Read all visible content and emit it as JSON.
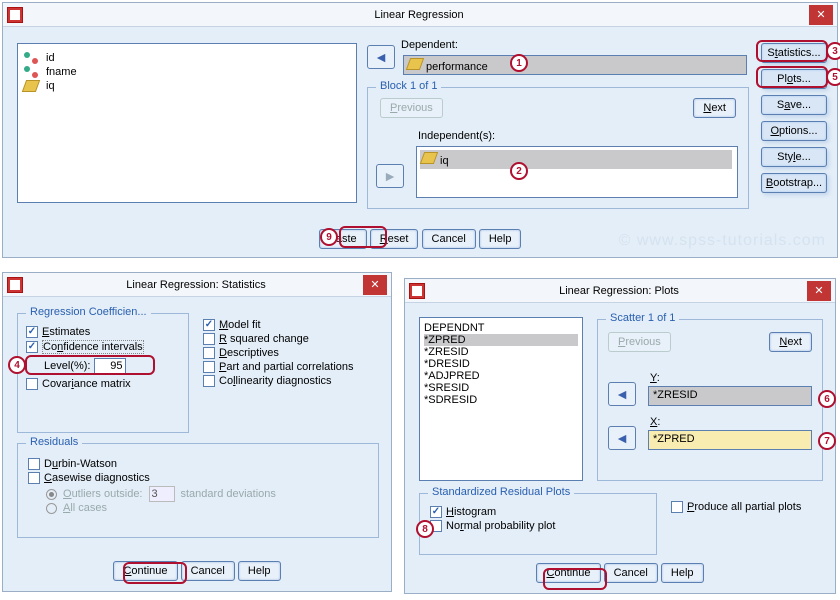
{
  "main": {
    "title": "Linear Regression",
    "vars": [
      {
        "icon": "balls",
        "label": "id"
      },
      {
        "icon": "balls",
        "label": "fname"
      },
      {
        "icon": "ruler",
        "label": "iq"
      }
    ],
    "dependent_label": "Dependent:",
    "dependent_value": "performance",
    "block_label": "Block 1 of 1",
    "previous": "Previous",
    "next": "Next",
    "independent_label": "Independent(s):",
    "independent_value": "iq",
    "buttons": {
      "paste": "Paste",
      "reset": "Reset",
      "cancel": "Cancel",
      "help": "Help"
    },
    "side": {
      "statistics": "Statistics...",
      "plots": "Plots...",
      "save": "Save...",
      "options": "Options...",
      "style": "Style...",
      "bootstrap": "Bootstrap..."
    }
  },
  "stats": {
    "title": "Linear Regression: Statistics",
    "regcoef_label": "Regression Coefficien...",
    "estimates": "Estimates",
    "confint": "Confidence intervals",
    "level_label": "Level(%):",
    "level_value": "95",
    "covmatrix": "Covariance matrix",
    "modelfit": "Model fit",
    "rsq": "R squared change",
    "descriptives": "Descriptives",
    "partcorr": "Part and partial correlations",
    "collin": "Collinearity diagnostics",
    "resid_label": "Residuals",
    "durbin": "Durbin-Watson",
    "casewise": "Casewise diagnostics",
    "outliers": "Outliers outside:",
    "outliers_value": "3",
    "stddev": "standard deviations",
    "allcases": "All cases",
    "continue": "Continue",
    "cancel": "Cancel",
    "help": "Help"
  },
  "plots": {
    "title": "Linear Regression: Plots",
    "list": [
      "DEPENDNT",
      "*ZPRED",
      "*ZRESID",
      "*DRESID",
      "*ADJPRED",
      "*SRESID",
      "*SDRESID"
    ],
    "scatter_label": "Scatter 1 of 1",
    "previous": "Previous",
    "next": "Next",
    "y_label": "Y:",
    "y_value": "*ZRESID",
    "x_label": "X:",
    "x_value": "*ZPRED",
    "stdres_label": "Standardized Residual Plots",
    "histogram": "Histogram",
    "normalprob": "Normal probability plot",
    "produce_all": "Produce all partial plots",
    "continue": "Continue",
    "cancel": "Cancel",
    "help": "Help"
  },
  "watermark": "© www.spss-tutorials.com"
}
